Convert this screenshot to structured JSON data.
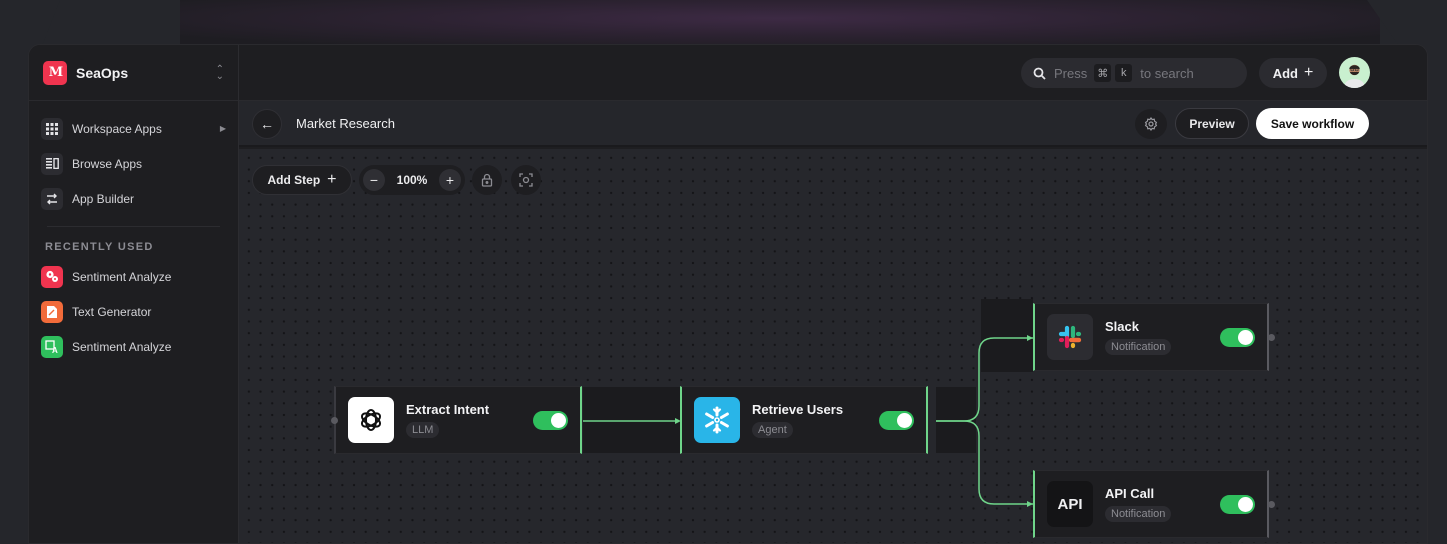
{
  "sidebar": {
    "brand": {
      "logo": "M",
      "name": "SeaOps"
    },
    "nav": [
      {
        "label": "Workspace Apps",
        "icon": "grid-icon",
        "has_submenu": true
      },
      {
        "label": "Browse Apps",
        "icon": "browse-icon",
        "has_submenu": false
      },
      {
        "label": "App Builder",
        "icon": "builder-icon",
        "has_submenu": false
      }
    ],
    "recent_label": "RECENTLY USED",
    "recent": [
      {
        "label": "Sentiment Analyze",
        "icon": "sentiment-icon",
        "color": "#f0344f"
      },
      {
        "label": "Text Generator",
        "icon": "text-generator-icon",
        "color": "#f26b3a"
      },
      {
        "label": "Sentiment Analyze",
        "icon": "translate-icon",
        "color": "#2fbf5d"
      }
    ]
  },
  "topbar": {
    "search": {
      "prefix": "Press",
      "key1": "⌘",
      "key2": "k",
      "suffix": "to search"
    },
    "add_label": "Add",
    "add_icon": "+"
  },
  "workflow": {
    "back_icon": "←",
    "title": "Market Research",
    "preview_label": "Preview",
    "save_label": "Save workflow"
  },
  "canvas_toolbar": {
    "add_step_label": "Add Step",
    "add_step_icon": "+",
    "zoom_minus": "−",
    "zoom_level": "100%",
    "zoom_plus": "+"
  },
  "nodes": [
    {
      "title": "Extract Intent",
      "badge": "LLM",
      "enabled": true,
      "icon": "openai-icon"
    },
    {
      "title": "Retrieve Users",
      "badge": "Agent",
      "enabled": true,
      "icon": "snowflake-icon"
    },
    {
      "title": "Slack",
      "badge": "Notification",
      "enabled": true,
      "icon": "slack-icon"
    },
    {
      "title": "API Call",
      "badge": "Notification",
      "enabled": true,
      "icon": "api-icon",
      "icon_text": "API"
    }
  ],
  "colors": {
    "accent": "#2fbf5d",
    "connector": "#6fd58a",
    "brand": "#f0344f"
  }
}
